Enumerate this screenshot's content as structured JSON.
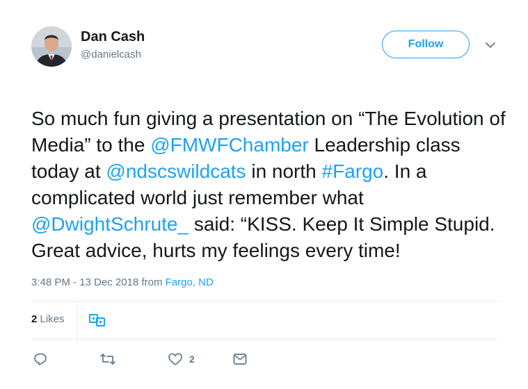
{
  "author": {
    "name": "Dan Cash",
    "handle": "@danielcash",
    "avatar_icon": "profile-photo"
  },
  "follow_button": {
    "label": "Follow"
  },
  "menu_icon": "chevron-down-icon",
  "tweet": {
    "segments": [
      {
        "text": "So much fun giving a presentation on “The Evolution of Media” to the ",
        "link": false
      },
      {
        "text": "@FMWFChamber",
        "link": true
      },
      {
        "text": " Leadership class today at ",
        "link": false
      },
      {
        "text": "@ndscswildcats",
        "link": true
      },
      {
        "text": " in north ",
        "link": false
      },
      {
        "text": "#Fargo",
        "link": true
      },
      {
        "text": ".  In a complicated world just remember what ",
        "link": false
      },
      {
        "text": "@DwightSchrute_",
        "link": true
      },
      {
        "text": " said: “KISS.  Keep It Simple Stupid.  Great advice, hurts my feelings every time!",
        "link": false
      }
    ]
  },
  "meta": {
    "timestamp": "3:48 PM - 13 Dec 2018",
    "from_label": " from ",
    "location": "Fargo, ND"
  },
  "stats": {
    "likes_count": "2",
    "likes_label": " Likes"
  },
  "actions": {
    "reply_icon": "reply-icon",
    "retweet_icon": "retweet-icon",
    "like_icon": "heart-icon",
    "like_count": "2",
    "dm_icon": "envelope-icon"
  },
  "colors": {
    "accent": "#1da1f2",
    "text": "#14171a",
    "muted": "#657786",
    "border": "#e6ecf0"
  }
}
